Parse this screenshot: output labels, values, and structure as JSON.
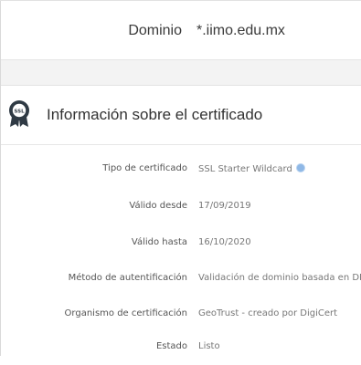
{
  "domain": {
    "label": "Dominio",
    "value": "*.iimo.edu.mx"
  },
  "certificate": {
    "icon": "ssl-badge-icon",
    "title": "Información sobre el certificado",
    "rows": [
      {
        "label": "Tipo de certificado",
        "value": "SSL Starter Wildcard",
        "info_icon": "info-icon"
      },
      {
        "label": "Válido desde",
        "value": "17/09/2019"
      },
      {
        "label": "Válido hasta",
        "value": "16/10/2020"
      },
      {
        "label": "Método de autentificación",
        "value": "Validación de dominio basada en DNS"
      },
      {
        "label": "Organismo de certificación",
        "value": "GeoTrust - creado por DigiCert"
      },
      {
        "label": "Estado",
        "value": "Listo"
      }
    ]
  },
  "colors": {
    "icon_dark": "#2f3a44",
    "info_blue": "#8fb8e6",
    "band": "#f3f3f3"
  }
}
